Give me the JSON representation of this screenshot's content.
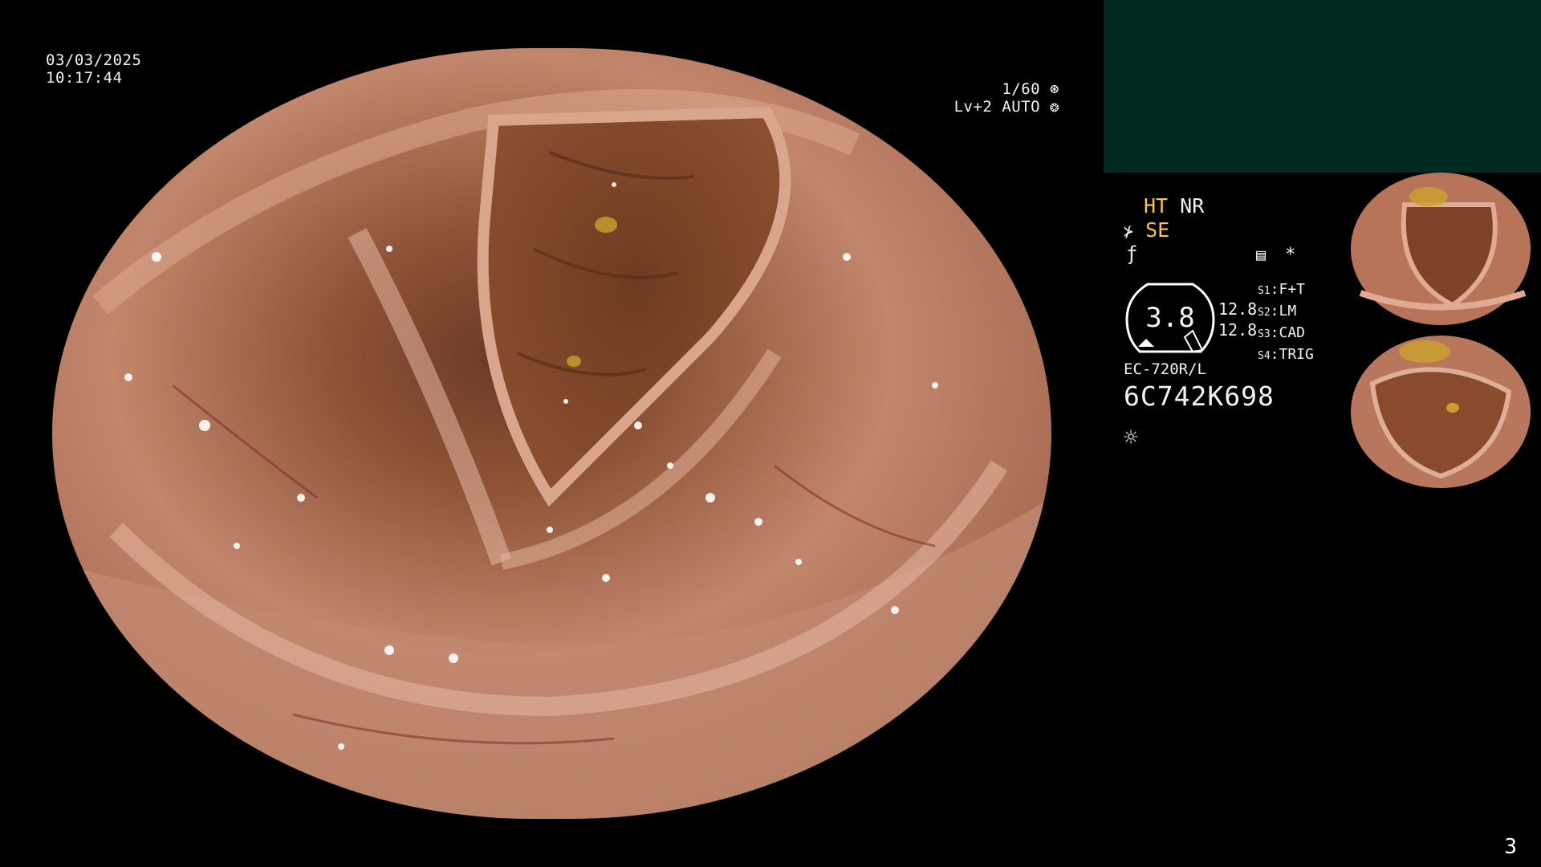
{
  "osd": {
    "date": "03/03/2025",
    "time": "10:17:44",
    "shutter": "1/60",
    "level": "Lv+2",
    "iris_mode": "AUTO"
  },
  "status": {
    "ht": "HT",
    "nr": "NR",
    "se": "SE"
  },
  "dial": {
    "value": "3.8"
  },
  "values": {
    "v1": "12.8",
    "v2": "12.8"
  },
  "slots": [
    {
      "key": "S1",
      "value": "F+T"
    },
    {
      "key": "S2",
      "value": "LM"
    },
    {
      "key": "S3",
      "value": "CAD"
    },
    {
      "key": "S4",
      "value": "TRIG"
    }
  ],
  "scope": {
    "model": "EC-720R/L",
    "serial": "6C742K698"
  },
  "page_number": "3",
  "colors": {
    "teal_panel": "#002922",
    "yellow_status": "#ffc83a",
    "mucosa": "#b8775f"
  },
  "icons": [
    "shutter-icon",
    "iris-icon",
    "structure-enhance-icon",
    "freeze-icon",
    "memory-icon",
    "asterisk-icon",
    "brightness-icon"
  ]
}
